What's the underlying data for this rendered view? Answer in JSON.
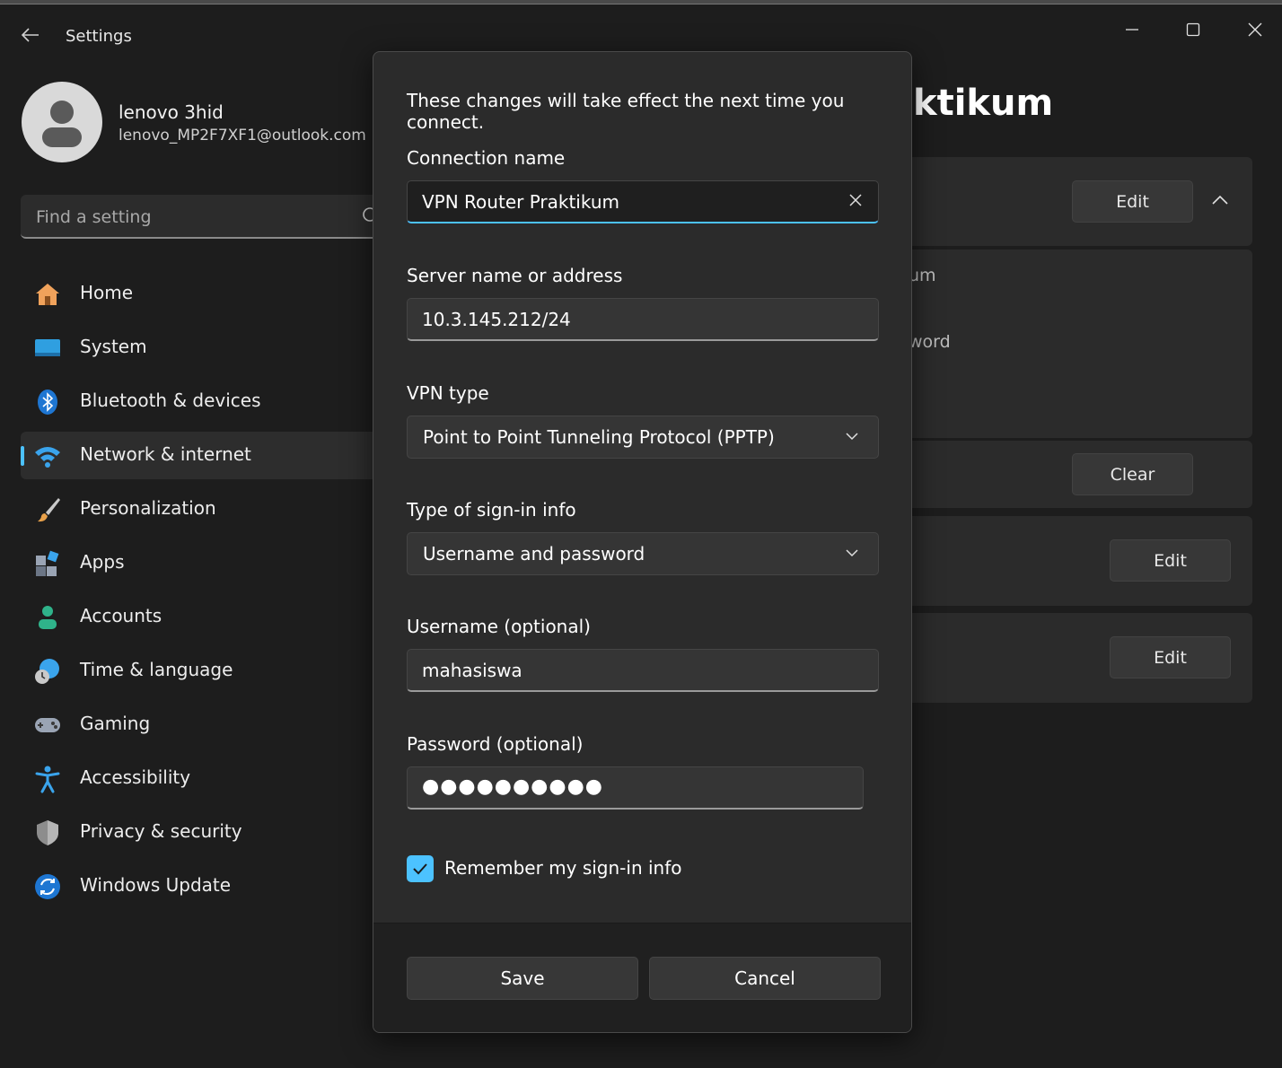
{
  "window": {
    "title": "Settings"
  },
  "profile": {
    "name": "lenovo 3hid",
    "email": "lenovo_MP2F7XF1@outlook.com"
  },
  "search": {
    "placeholder": "Find a setting"
  },
  "nav": {
    "items": [
      {
        "label": "Home",
        "icon": "home-icon"
      },
      {
        "label": "System",
        "icon": "system-icon"
      },
      {
        "label": "Bluetooth & devices",
        "icon": "bluetooth-icon"
      },
      {
        "label": "Network & internet",
        "icon": "network-icon",
        "selected": true
      },
      {
        "label": "Personalization",
        "icon": "brush-icon"
      },
      {
        "label": "Apps",
        "icon": "apps-icon"
      },
      {
        "label": "Accounts",
        "icon": "accounts-icon"
      },
      {
        "label": "Time & language",
        "icon": "time-language-icon"
      },
      {
        "label": "Gaming",
        "icon": "gamepad-icon"
      },
      {
        "label": "Accessibility",
        "icon": "accessibility-icon"
      },
      {
        "label": "Privacy & security",
        "icon": "shield-icon"
      },
      {
        "label": "Windows Update",
        "icon": "windows-update-icon"
      }
    ]
  },
  "background_page": {
    "heading_fragment": "aktikum",
    "frag_1": "um",
    "frag_2": "word",
    "edit_label": "Edit",
    "clear_label": "Clear"
  },
  "dialog": {
    "note": "These changes will take effect the next time you connect.",
    "connection_name_label": "Connection name",
    "connection_name_value": "VPN Router Praktikum",
    "server_label": "Server name or address",
    "server_value": "10.3.145.212/24",
    "vpn_type_label": "VPN type",
    "vpn_type_value": "Point to Point Tunneling Protocol (PPTP)",
    "signin_type_label": "Type of sign-in info",
    "signin_type_value": "Username and password",
    "username_label": "Username (optional)",
    "username_value": "mahasiswa",
    "password_label": "Password (optional)",
    "password_value": "●●●●●●●●●●",
    "remember_label": "Remember my sign-in info",
    "remember_checked": true,
    "save_label": "Save",
    "cancel_label": "Cancel"
  },
  "colors": {
    "accent": "#4cc2ff",
    "background": "#1d1d1d",
    "dialog": "#2b2b2b"
  }
}
